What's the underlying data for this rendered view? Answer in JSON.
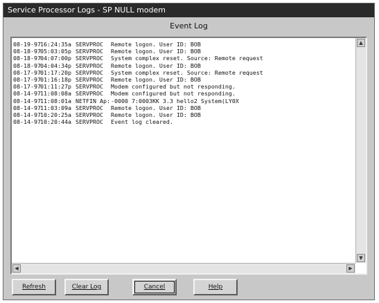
{
  "window": {
    "title": "Service Processor Logs - SP NULL modem"
  },
  "log": {
    "heading": "Event Log",
    "rows": [
      {
        "date": "08-19-97",
        "time": "16:24:35a",
        "source": "SERVPROC",
        "message": "Remote logon. User ID: BOB"
      },
      {
        "date": "08-18-97",
        "time": "05:03:05p",
        "source": "SERVPROC",
        "message": "Remote logon. User ID: BOB"
      },
      {
        "date": "08-18-97",
        "time": "04:07:00p",
        "source": "SERVPROC",
        "message": "System complex reset. Source: Remote request"
      },
      {
        "date": "08-18-97",
        "time": "04:04:34p",
        "source": "SERVPROC",
        "message": "Remote logon. User ID: BOB"
      },
      {
        "date": "08-17-97",
        "time": "01:17:20p",
        "source": "SERVPROC",
        "message": "System complex reset. Source: Remote request"
      },
      {
        "date": "08-17-97",
        "time": "01:16:18p",
        "source": "SERVPROC",
        "message": "Remote logon. User ID: BOB"
      },
      {
        "date": "08-17-97",
        "time": "01:11:27p",
        "source": "SERVPROC",
        "message": "Modem configured but not responding."
      },
      {
        "date": "08-14-97",
        "time": "11:08:08a",
        "source": "SERVPROC",
        "message": "Modem configured but not responding."
      },
      {
        "date": "08-14-97",
        "time": "11:08:01a",
        "source": "NETFIN   Ap:",
        "message": "      -0000 7:0003KK 3.3 hello2 System(LY0X"
      },
      {
        "date": "08-14-97",
        "time": "11:03:09a",
        "source": "SERVPROC",
        "message": "Remote logon. User ID: BOB"
      },
      {
        "date": "08-14-97",
        "time": "10:20:25a",
        "source": "SERVPROC",
        "message": "Remote logon. User ID: BOB"
      },
      {
        "date": "08-14-97",
        "time": "10:20:44a",
        "source": "SERVPROC",
        "message": "Event log cleared."
      }
    ]
  },
  "buttons": {
    "refresh": "Refresh",
    "clear_log": "Clear Log",
    "cancel": "Cancel",
    "help": "Help"
  }
}
